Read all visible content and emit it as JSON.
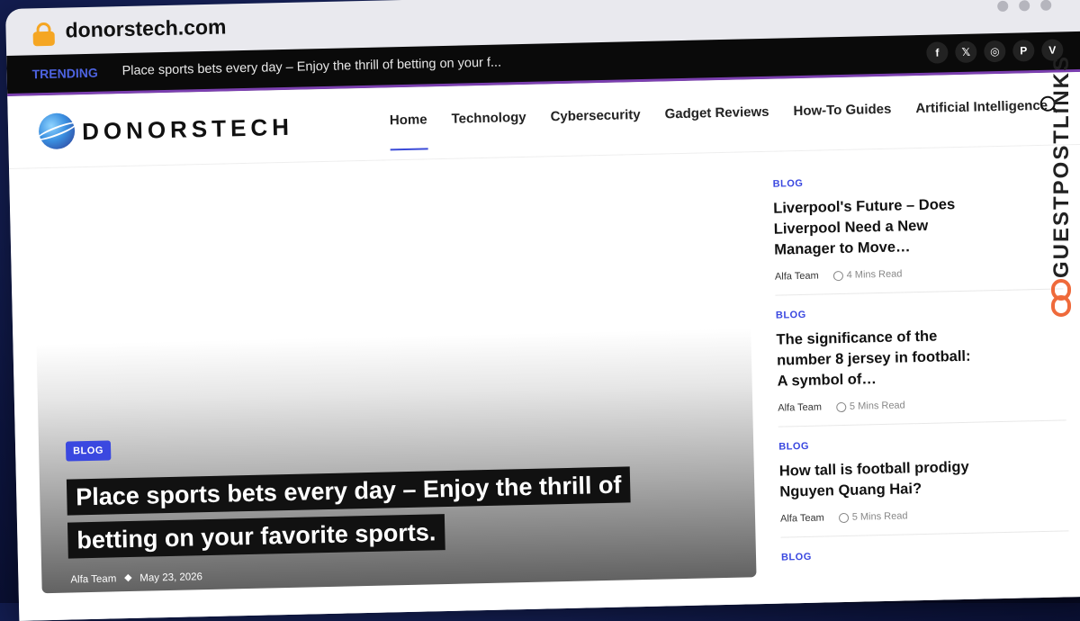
{
  "browser": {
    "url": "donorstech.com"
  },
  "trending": {
    "label": "TRENDING",
    "text": "Place sports bets every day – Enjoy the thrill of betting on your f..."
  },
  "social": [
    "f",
    "𝕏",
    "◎",
    "P",
    "V"
  ],
  "site": {
    "logo_text": "DONORSTECH"
  },
  "nav": {
    "items": [
      "Home",
      "Technology",
      "Cybersecurity",
      "Gadget Reviews",
      "How-To Guides",
      "Artificial Intelligence"
    ],
    "active": "Home"
  },
  "hero": {
    "category": "BLOG",
    "title": "Place sports bets every day – Enjoy the thrill of betting on your favorite sports.",
    "author": "Alfa Team",
    "date": "May 23, 2026"
  },
  "sidebar": {
    "posts": [
      {
        "category": "BLOG",
        "title": "Liverpool's Future – Does Liverpool Need a New Manager to Move…",
        "author": "Alfa Team",
        "read_time": "4 Mins Read"
      },
      {
        "category": "BLOG",
        "title": "The significance of the number 8 jersey in football: A symbol of…",
        "author": "Alfa Team",
        "read_time": "5 Mins Read"
      },
      {
        "category": "BLOG",
        "title": "How tall is football prodigy Nguyen Quang Hai?",
        "author": "Alfa Team",
        "read_time": "5 Mins Read"
      },
      {
        "category": "BLOG",
        "title": "",
        "author": "",
        "read_time": ""
      }
    ]
  },
  "watermark": {
    "text": "GUESTPOSTLINKS"
  },
  "colors": {
    "accent": "#3a48e0",
    "trend_border": "#7b3fb0",
    "watermark_icon": "#ef6a3b"
  }
}
